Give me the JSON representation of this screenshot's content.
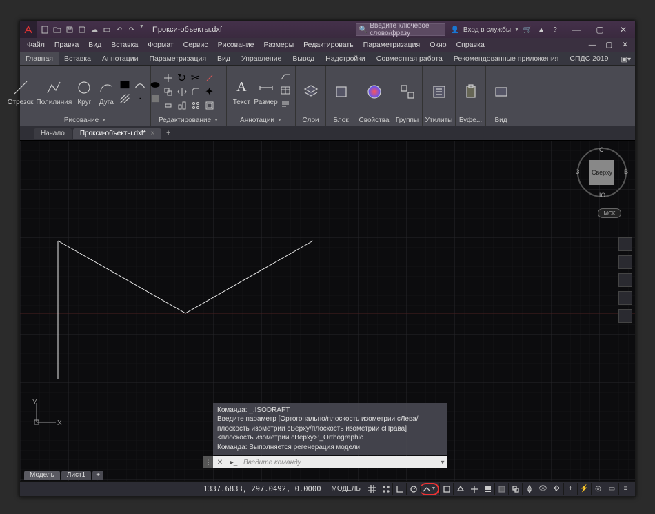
{
  "window": {
    "title": "Прокси-объекты.dxf",
    "search_placeholder": "Введите ключевое слово/фразу",
    "login_label": "Вход в службы",
    "app_letter": "A"
  },
  "menubar": [
    "Файл",
    "Правка",
    "Вид",
    "Вставка",
    "Формат",
    "Сервис",
    "Рисование",
    "Размеры",
    "Редактировать",
    "Параметризация",
    "Окно",
    "Справка"
  ],
  "ribbon": {
    "tabs": [
      "Главная",
      "Вставка",
      "Аннотации",
      "Параметризация",
      "Вид",
      "Управление",
      "Вывод",
      "Надстройки",
      "Совместная работа",
      "Рекомендованные приложения",
      "СПДС 2019"
    ],
    "active_tab": 0,
    "panels": {
      "draw": {
        "label": "Рисование",
        "btns": [
          "Отрезок",
          "Полилиния",
          "Круг",
          "Дуга"
        ]
      },
      "edit": {
        "label": "Редактирование"
      },
      "annot": {
        "label": "Аннотации",
        "btns": [
          "Текст",
          "Размер"
        ]
      },
      "layers": {
        "label": "Слои"
      },
      "block": {
        "label": "Блок"
      },
      "props": {
        "label": "Свойства"
      },
      "groups": {
        "label": "Группы"
      },
      "utils": {
        "label": "Утилиты"
      },
      "clip": {
        "label": "Буфе..."
      },
      "view": {
        "label": "Вид"
      }
    }
  },
  "filetabs": {
    "items": [
      "Начало",
      "Прокси-объекты.dxf*"
    ],
    "active": 1
  },
  "viewcube": {
    "face": "Сверху",
    "n": "С",
    "s": "Ю",
    "e": "В",
    "w": "З",
    "wcs": "МСК"
  },
  "ucs": {
    "x": "X",
    "y": "Y"
  },
  "command": {
    "line1": "Команда: _.ISODRAFT",
    "line2": "Введите параметр [Ортогонально/плоскость изометрии сЛева/плоскость изометрии сВерху/плоскость изометрии сПрава] <плоскость изометрии сВерху>:_Orthographic",
    "line3": "Команда: Выполняется регенерация модели.",
    "input_placeholder": "Введите команду"
  },
  "layout_tabs": {
    "items": [
      "Модель",
      "Лист1"
    ],
    "active": 0
  },
  "status": {
    "coords": "1337.6833, 297.0492, 0.0000",
    "model": "МОДЕЛЬ"
  }
}
